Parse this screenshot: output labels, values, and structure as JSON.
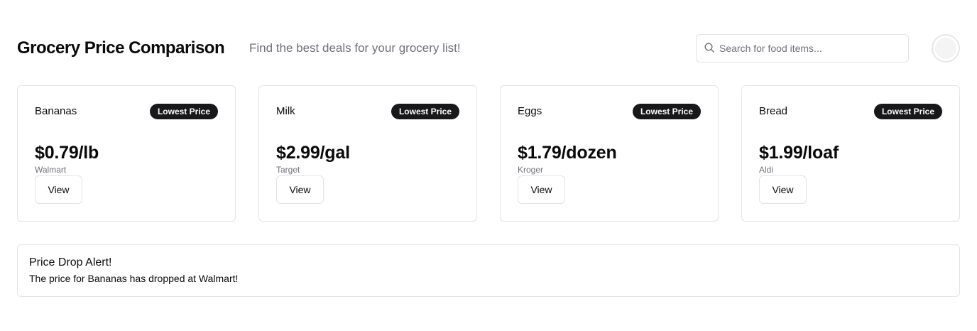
{
  "header": {
    "title": "Grocery Price Comparison",
    "subtitle": "Find the best deals for your grocery list!",
    "search_placeholder": "Search for food items...",
    "search_value": ""
  },
  "cards": [
    {
      "name": "Bananas",
      "badge": "Lowest Price",
      "price": "$0.79/lb",
      "store": "Walmart",
      "button": "View"
    },
    {
      "name": "Milk",
      "badge": "Lowest Price",
      "price": "$2.99/gal",
      "store": "Target",
      "button": "View"
    },
    {
      "name": "Eggs",
      "badge": "Lowest Price",
      "price": "$1.79/dozen",
      "store": "Kroger",
      "button": "View"
    },
    {
      "name": "Bread",
      "badge": "Lowest Price",
      "price": "$1.99/loaf",
      "store": "Aldi",
      "button": "View"
    }
  ],
  "alert": {
    "title": "Price Drop Alert!",
    "message": "The price for Bananas has dropped at Walmart!"
  },
  "colors": {
    "badge_bg": "#18181b",
    "muted_text": "#71717a",
    "border": "#e4e4e7"
  },
  "icons": {
    "search": "search-icon",
    "avatar": "avatar"
  }
}
